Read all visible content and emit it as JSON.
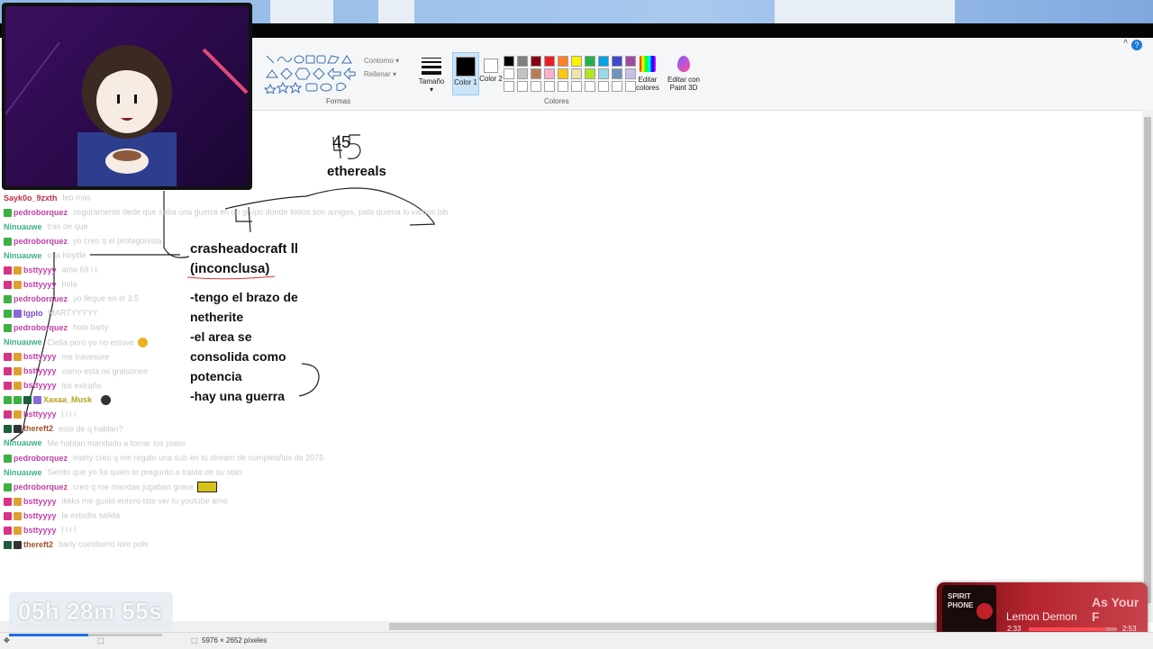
{
  "ribbon": {
    "contorno_label": "Contorno",
    "rellenar_label": "Rellenar",
    "formas_group": "Formas",
    "size_label": "Tamaño",
    "color1_label": "Color 1",
    "color2_label": "Color 2",
    "colores_group": "Colores",
    "edit_colors_label": "Editar colores",
    "paint3d_label": "Editar con Paint 3D",
    "palette": [
      "#000000",
      "#7f7f7f",
      "#880015",
      "#ed1c24",
      "#ff7f27",
      "#fff200",
      "#22b14c",
      "#00a2e8",
      "#3f48cc",
      "#a349a4",
      "#ffffff",
      "#c3c3c3",
      "#b97a57",
      "#ffaec9",
      "#ffc90e",
      "#efe4b0",
      "#b5e61d",
      "#99d9ea",
      "#7092be",
      "#c8bfe7",
      "#ffffff",
      "#ffffff",
      "#ffffff",
      "#ffffff",
      "#ffffff",
      "#ffffff",
      "#ffffff",
      "#ffffff",
      "#ffffff",
      "#ffffff"
    ]
  },
  "canvas": {
    "number": "45",
    "ethereals": "ethereals",
    "crash_title_1": "crasheadocraft ll",
    "crash_title_2": "(inconclusa)",
    "note1": "-tengo el brazo de",
    "note2": "netherite",
    "note3": "-el area se",
    "note4": "consolida como",
    "note5": "potencia",
    "note6": "-hay una guerra"
  },
  "chat": [
    {
      "user": "Sayk0o_9zxth",
      "color": "#c0304a",
      "badges": [],
      "msg": "leo mas"
    },
    {
      "user": "pedroborquez",
      "color": "#c23fa8",
      "badges": [
        "#3cb043"
      ],
      "msg": "seguramente dede que saba una guerra en un grupo donde todos son amigos, pata quiena lo vamos jsb"
    },
    {
      "user": "Ninuauwe",
      "color": "#3bb18a",
      "badges": [],
      "msg": "tras de que"
    },
    {
      "user": "pedroborquez",
      "color": "#c23fa8",
      "badges": [
        "#3cb043"
      ],
      "msg": "yo creo q el protagonista"
    },
    {
      "user": "Ninuauwe",
      "color": "#3bb18a",
      "badges": [],
      "msg": "o la hoyitle"
    },
    {
      "user": "bsttyyyy",
      "color": "#c23fa8",
      "badges": [
        "#d63384",
        "#e0a030"
      ],
      "msg": "amo 69 l l"
    },
    {
      "user": "bsttyyyy",
      "color": "#c23fa8",
      "badges": [
        "#d63384",
        "#e0a030"
      ],
      "msg": "hola"
    },
    {
      "user": "pedroborquez",
      "color": "#c23fa8",
      "badges": [
        "#3cb043"
      ],
      "msg": "yo llegue en el 3.5"
    },
    {
      "user": "lgplo",
      "color": "#7b4ac9",
      "badges": [
        "#3cb043",
        "#8a6ad6"
      ],
      "msg": "MARTYYYYY"
    },
    {
      "user": "pedroborquez",
      "color": "#c23fa8",
      "badges": [
        "#3cb043"
      ],
      "msg": "hola barty"
    },
    {
      "user": "Ninuauwe",
      "color": "#3bb18a",
      "badges": [],
      "msg": "Cielia pero yo no estuve"
    },
    {
      "user": "bsttyyyy",
      "color": "#c23fa8",
      "badges": [
        "#d63384",
        "#e0a030"
      ],
      "msg": "me travesure"
    },
    {
      "user": "bsttyyyy",
      "color": "#c23fa8",
      "badges": [
        "#d63384",
        "#e0a030"
      ],
      "msg": "como esta mi gralsonee"
    },
    {
      "user": "bsttyyyy",
      "color": "#c23fa8",
      "badges": [
        "#d63384",
        "#e0a030"
      ],
      "msg": "los extraño"
    },
    {
      "user": "Xaxaa_Musk",
      "color": "#b8a21a",
      "badges": [
        "#3cb043",
        "#3cb043",
        "#1b5e3c",
        "#8a6ad6"
      ],
      "msg": ""
    },
    {
      "user": "bsttyyyy",
      "color": "#c23fa8",
      "badges": [
        "#d63384",
        "#e0a030"
      ],
      "msg": "l l l l"
    },
    {
      "user": "thereft2",
      "color": "#a0522d",
      "badges": [
        "#1b5e3c",
        "#333333"
      ],
      "msg": "este de q hablan?"
    },
    {
      "user": "Ninuauwe",
      "color": "#3bb18a",
      "badges": [],
      "msg": "Me hablan mandado a tomar los pialor"
    },
    {
      "user": "pedroborquez",
      "color": "#c23fa8",
      "badges": [
        "#3cb043"
      ],
      "msg": "marty creo q me regalo una sub en tu stream de cumpleaños de 2075"
    },
    {
      "user": "Ninuauwe",
      "color": "#3bb18a",
      "badges": [],
      "msg": "Siento que yo fui quien te pregunto a traida de su stan"
    },
    {
      "user": "pedroborquez",
      "color": "#c23fa8",
      "badges": [
        "#3cb043"
      ],
      "msg": "creo q me mandas jugaban grave"
    },
    {
      "user": "bsttyyyy",
      "color": "#c23fa8",
      "badges": [
        "#d63384",
        "#e0a030"
      ],
      "msg": "ikkks me gusto entero tste ver tu youtube amo"
    },
    {
      "user": "bsttyyyy",
      "color": "#c23fa8",
      "badges": [
        "#d63384",
        "#e0a030"
      ],
      "msg": "la estudia salida"
    },
    {
      "user": "bsttyyyy",
      "color": "#c23fa8",
      "badges": [
        "#d63384",
        "#e0a030"
      ],
      "msg": "l l l l"
    },
    {
      "user": "thereft2",
      "color": "#a0522d",
      "badges": [
        "#1b5e3c",
        "#333333"
      ],
      "msg": "barly cuestiamo lore pols"
    }
  ],
  "timer": "05h 28m 55s",
  "music": {
    "title": "As Your F",
    "artist": "Lemon Demon",
    "elapsed": "2:33",
    "total": "2:53",
    "progress": 0.88,
    "cover_text_1": "SPIRIT",
    "cover_text_2": "PHONE"
  },
  "status": {
    "dimensions": "5976 × 2652 píxeles"
  }
}
